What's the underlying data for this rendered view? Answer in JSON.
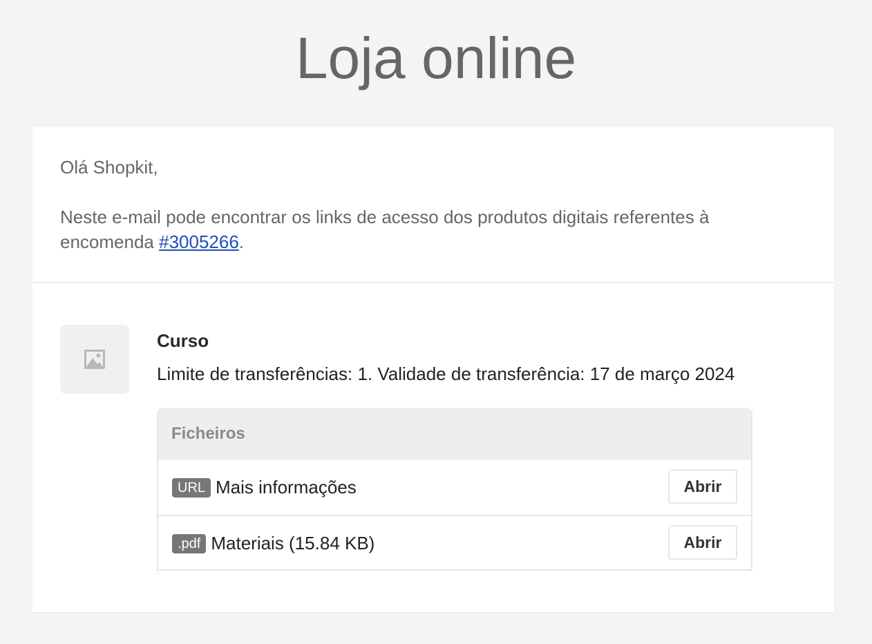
{
  "store": {
    "title": "Loja online"
  },
  "intro": {
    "greeting": "Olá Shopkit,",
    "message_before": "Neste e-mail pode encontrar os links de acesso dos produtos digitais referentes à encomenda ",
    "order_link": "#3005266",
    "message_after": "."
  },
  "product": {
    "image_icon": "image-placeholder-icon",
    "name": "Curso",
    "meta": "Limite de transferências: 1. Validade de transferência: 17 de março 2024"
  },
  "files": {
    "header": "Ficheiros",
    "items": [
      {
        "badge": "URL",
        "label": "Mais informações",
        "button": "Abrir"
      },
      {
        "badge": ".pdf",
        "label": "Materiais (15.84 KB)",
        "button": "Abrir"
      }
    ]
  },
  "colors": {
    "background": "#f4f4f4",
    "card": "#ffffff",
    "link": "#1d4fb8",
    "badge": "#777777"
  }
}
